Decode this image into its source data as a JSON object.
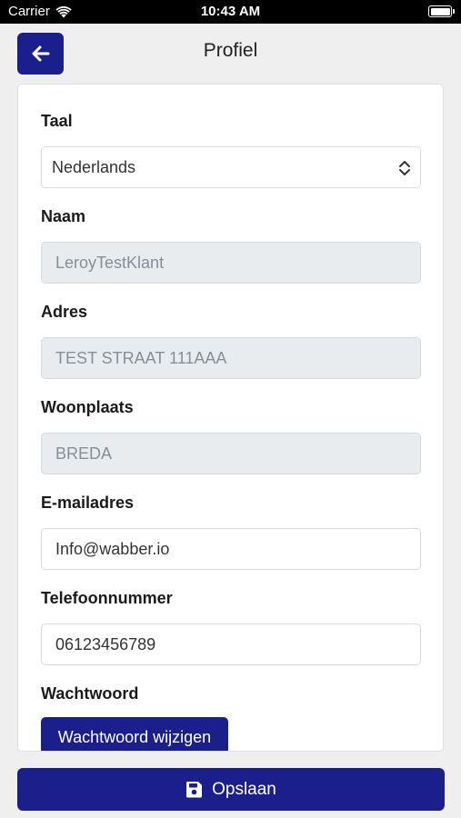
{
  "status_bar": {
    "carrier": "Carrier",
    "time": "10:43 AM"
  },
  "header": {
    "title": "Profiel",
    "back_icon": "arrow-left-icon"
  },
  "form": {
    "language": {
      "label": "Taal",
      "value": "Nederlands"
    },
    "name": {
      "label": "Naam",
      "value": "LeroyTestKlant"
    },
    "address": {
      "label": "Adres",
      "value": "TEST STRAAT 111AAA"
    },
    "city": {
      "label": "Woonplaats",
      "value": "BREDA"
    },
    "email": {
      "label": "E-mailadres",
      "value": "Info@wabber.io"
    },
    "phone": {
      "label": "Telefoonnummer",
      "value": "06123456789"
    },
    "password": {
      "label": "Wachtwoord",
      "button_label": "Wachtwoord wijzigen"
    }
  },
  "footer": {
    "save_label": "Opslaan",
    "save_icon": "floppy-disk-icon"
  },
  "colors": {
    "primary": "#1b1f8c",
    "disabled_bg": "#e9ecef"
  }
}
